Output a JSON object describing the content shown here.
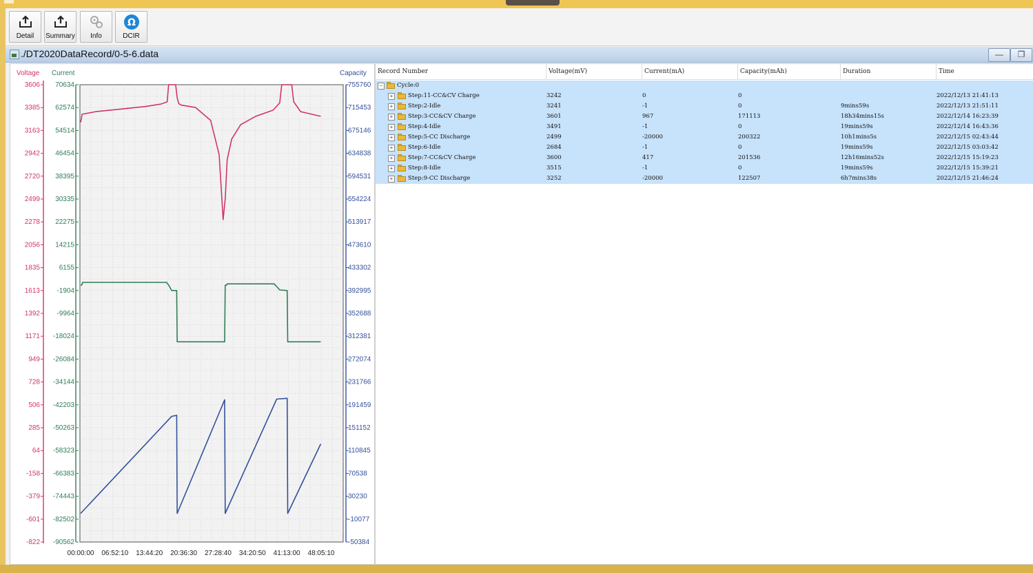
{
  "toolbar": {
    "buttons": [
      {
        "label": "Detail",
        "icon": "export-icon"
      },
      {
        "label": "Summary",
        "icon": "export-icon"
      },
      {
        "label": "Info",
        "icon": "gears-icon"
      },
      {
        "label": "DCIR",
        "icon": "ohm-icon"
      }
    ]
  },
  "document": {
    "title": "./DT2020DataRecord/0-5-6.data"
  },
  "colors": {
    "voltage": "#d0346a",
    "current": "#2e7d55",
    "capacity": "#33509a",
    "selection": "#c7e2fb"
  },
  "chart_data": {
    "type": "line",
    "axis_titles": {
      "voltage": "Voltage",
      "current": "Current",
      "capacity": "Capacity"
    },
    "voltage_ticks": [
      "3606",
      "3385",
      "3163",
      "2942",
      "2720",
      "2499",
      "2278",
      "2056",
      "1835",
      "1613",
      "1392",
      "1171",
      "949",
      "728",
      "506",
      "285",
      "64",
      "-158",
      "-379",
      "-601",
      "-822"
    ],
    "current_ticks": [
      "70634",
      "62574",
      "54514",
      "46454",
      "38395",
      "30335",
      "22275",
      "14215",
      "6155",
      "-1904",
      "-9964",
      "-18024",
      "-26084",
      "-34144",
      "-42203",
      "-50263",
      "-58323",
      "-66383",
      "-74443",
      "-82502",
      "-90562"
    ],
    "capacity_ticks": [
      "755760",
      "715453",
      "675146",
      "634838",
      "594531",
      "554224",
      "513917",
      "473610",
      "433302",
      "392995",
      "352688",
      "312381",
      "272074",
      "231766",
      "191459",
      "151152",
      "110845",
      "70538",
      "30230",
      "-10077",
      "-50384"
    ],
    "x_ticks": [
      "00:00:00",
      "06:52:10",
      "13:44:20",
      "20:36:30",
      "27:28:40",
      "34:20:50",
      "41:13:00",
      "48:05:10"
    ],
    "x_unit": "hours",
    "xlim": [
      0,
      48.086
    ],
    "voltage_ylim": [
      -822,
      3606
    ],
    "current_ylim": [
      -90562,
      70634
    ],
    "capacity_ylim": [
      -50384,
      755760
    ],
    "grid": true,
    "series": [
      {
        "name": "Voltage",
        "axis": "voltage",
        "x": [
          0,
          0.3,
          3,
          8,
          13,
          16,
          17.3,
          17.6,
          19,
          19.3,
          19.6,
          20,
          23,
          26,
          27.7,
          28.5,
          28.9,
          29.3,
          30.2,
          32,
          35,
          38.5,
          39.8,
          40.2,
          42.2,
          42.6,
          44,
          48
        ],
        "y": [
          3242,
          3320,
          3345,
          3370,
          3395,
          3418,
          3440,
          3606,
          3606,
          3480,
          3425,
          3410,
          3385,
          3260,
          2930,
          2300,
          2500,
          2880,
          3080,
          3220,
          3300,
          3360,
          3430,
          3606,
          3606,
          3440,
          3345,
          3300
        ]
      },
      {
        "name": "Current",
        "axis": "current",
        "x": [
          0,
          0.2,
          0.4,
          17.2,
          17.7,
          18.2,
          19.2,
          19.3,
          28.8,
          28.9,
          29.2,
          29.3,
          38.7,
          39.2,
          39.8,
          41.3,
          41.4,
          48
        ],
        "y": [
          0,
          0,
          967,
          967,
          -300,
          -1904,
          -1904,
          -20000,
          -20000,
          0,
          0,
          417,
          417,
          -500,
          -1700,
          -1904,
          -20000,
          -20000
        ]
      },
      {
        "name": "Capacity",
        "axis": "capacity",
        "x": [
          0,
          18.2,
          19.2,
          19.3,
          28.8,
          28.9,
          39.2,
          41.3,
          41.4,
          48
        ],
        "y": [
          0,
          171113,
          173000,
          0,
          200322,
          0,
          201536,
          203000,
          0,
          122507
        ]
      }
    ]
  },
  "table": {
    "columns": [
      "Record Number",
      "Voltage(mV)",
      "Current(mA)",
      "Capacity(mAh)",
      "Duration",
      "Time"
    ],
    "cycle_label": "Cycle:0",
    "rows": [
      {
        "name": "Step:11-CC&CV Charge",
        "voltage": "3242",
        "current": "0",
        "capacity": "0",
        "duration": "",
        "time": "2022/12/13 21:41:13"
      },
      {
        "name": "Step:2-Idle",
        "voltage": "3241",
        "current": "-1",
        "capacity": "0",
        "duration": "9mins59s",
        "time": "2022/12/13 21:51:11"
      },
      {
        "name": "Step:3-CC&CV Charge",
        "voltage": "3601",
        "current": "967",
        "capacity": "171113",
        "duration": "18h34mins15s",
        "time": "2022/12/14 16:23:39"
      },
      {
        "name": "Step:4-Idle",
        "voltage": "3491",
        "current": "-1",
        "capacity": "0",
        "duration": "19mins59s",
        "time": "2022/12/14 16:43:36"
      },
      {
        "name": "Step:5-CC Discharge",
        "voltage": "2499",
        "current": "-20000",
        "capacity": "200322",
        "duration": "10h1mins5s",
        "time": "2022/12/15 02:43:44"
      },
      {
        "name": "Step:6-Idle",
        "voltage": "2684",
        "current": "-1",
        "capacity": "0",
        "duration": "19mins59s",
        "time": "2022/12/15 03:03:42"
      },
      {
        "name": "Step:7-CC&CV Charge",
        "voltage": "3600",
        "current": "417",
        "capacity": "201536",
        "duration": "12h16mins52s",
        "time": "2022/12/15 15:19:23"
      },
      {
        "name": "Step:8-Idle",
        "voltage": "3515",
        "current": "-1",
        "capacity": "0",
        "duration": "19mins59s",
        "time": "2022/12/15 15:39:21"
      },
      {
        "name": "Step:9-CC Discharge",
        "voltage": "3252",
        "current": "-20000",
        "capacity": "122507",
        "duration": "6h7mins38s",
        "time": "2022/12/15 21:46:24"
      }
    ]
  }
}
